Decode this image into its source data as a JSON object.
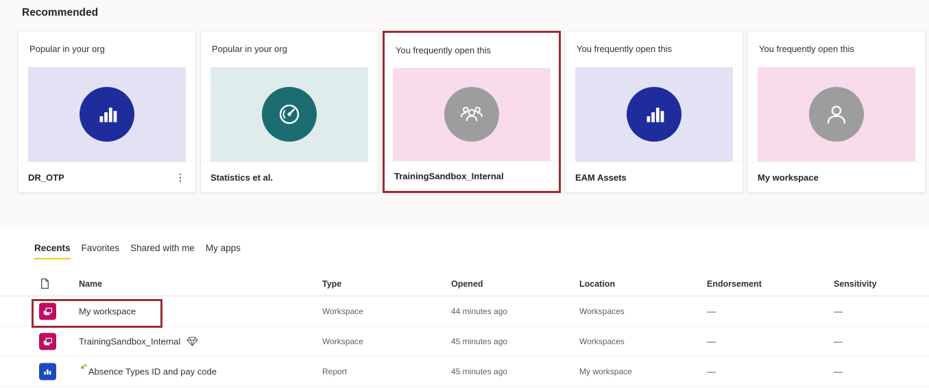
{
  "recommended": {
    "heading": "Recommended",
    "cards": [
      {
        "label": "Popular in your org",
        "title": "DR_OTP",
        "icon": "bar-chart",
        "thumb_bg": "#e2e2f4",
        "circle_color": "#1f2c9c",
        "highlighted": false,
        "has_menu": true
      },
      {
        "label": "Popular in your org",
        "title": "Statistics et al.",
        "icon": "gauge",
        "thumb_bg": "#dfecec",
        "circle_color": "#1b6d72",
        "highlighted": false,
        "has_menu": false
      },
      {
        "label": "You frequently open this",
        "title": "TrainingSandbox_Internal",
        "icon": "people",
        "thumb_bg": "#f8dcec",
        "circle_color": "#9d9d9d",
        "highlighted": true,
        "has_menu": false
      },
      {
        "label": "You frequently open this",
        "title": "EAM Assets",
        "icon": "bar-chart",
        "thumb_bg": "#e2e2f4",
        "circle_color": "#1f2c9c",
        "highlighted": false,
        "has_menu": false
      },
      {
        "label": "You frequently open this",
        "title": "My workspace",
        "icon": "person",
        "thumb_bg": "#f8dcec",
        "circle_color": "#9d9d9d",
        "highlighted": false,
        "has_menu": false
      }
    ]
  },
  "tabs": [
    {
      "label": "Recents",
      "active": true
    },
    {
      "label": "Favorites",
      "active": false
    },
    {
      "label": "Shared with me",
      "active": false
    },
    {
      "label": "My apps",
      "active": false
    }
  ],
  "table": {
    "columns": {
      "name": "Name",
      "type": "Type",
      "opened": "Opened",
      "location": "Location",
      "endorsement": "Endorsement",
      "sensitivity": "Sensitivity"
    },
    "rows": [
      {
        "name": "My workspace",
        "icon": "workspace",
        "icon_color": "#bf0d63",
        "type": "Workspace",
        "opened": "44 minutes ago",
        "location": "Workspaces",
        "endorsement": "—",
        "sensitivity": "—",
        "highlighted": true,
        "premium": false,
        "is_new": false
      },
      {
        "name": "TrainingSandbox_Internal",
        "icon": "workspace",
        "icon_color": "#bf0d63",
        "type": "Workspace",
        "opened": "45 minutes ago",
        "location": "Workspaces",
        "endorsement": "—",
        "sensitivity": "—",
        "highlighted": false,
        "premium": true,
        "is_new": false
      },
      {
        "name": "Absence Types ID and pay code",
        "icon": "report",
        "icon_color": "#1f49c0",
        "type": "Report",
        "opened": "45 minutes ago",
        "location": "My workspace",
        "endorsement": "—",
        "sensitivity": "—",
        "highlighted": false,
        "premium": false,
        "is_new": true
      }
    ]
  },
  "colors": {
    "page_bg": "#faf9f8",
    "panel_bg": "#ffffff",
    "accent_tab_underline": "#f2c811",
    "annotation_highlight_red": "#9b2c34",
    "workspace_icon": "#bf0d63",
    "report_icon": "#1f49c0",
    "card_circle_blue": "#1f2c9c",
    "card_circle_teal": "#1b6d72",
    "card_circle_gray": "#9d9d9d"
  }
}
